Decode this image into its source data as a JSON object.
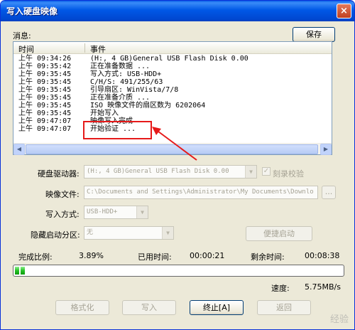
{
  "window": {
    "title": "写入硬盘映像",
    "close_glyph": "×"
  },
  "messages": {
    "label": "消息:",
    "save_button": "保存",
    "columns": {
      "time": "时间",
      "event": "事件"
    },
    "rows": [
      {
        "time": "上午 09:34:26",
        "event": "(H:, 4 GB)General USB Flash Disk  0.00"
      },
      {
        "time": "上午 09:35:42",
        "event": "正在准备数据 ..."
      },
      {
        "time": "上午 09:35:45",
        "event": "写入方式: USB-HDD+"
      },
      {
        "time": "上午 09:35:45",
        "event": "C/H/S: 491/255/63"
      },
      {
        "time": "上午 09:35:45",
        "event": "引导扇区: WinVista/7/8"
      },
      {
        "time": "上午 09:35:45",
        "event": "正在准备介质 ..."
      },
      {
        "time": "上午 09:35:45",
        "event": "ISO 映像文件的扇区数为 6202064"
      },
      {
        "time": "上午 09:35:45",
        "event": "开始写入"
      },
      {
        "time": "上午 09:47:07",
        "event": "映像写入完成"
      },
      {
        "time": "上午 09:47:07",
        "event": "开始验证 ..."
      }
    ],
    "scroll_left": "◀",
    "scroll_right": "▶"
  },
  "form": {
    "drive_label": "硬盘驱动器:",
    "drive_value": "(H:, 4 GB)General USB Flash Disk  0.00",
    "verify_label": "刻录校验",
    "verify_checked": true,
    "image_label": "映像文件:",
    "image_value": "C:\\Documents and Settings\\Administrator\\My Documents\\Downlo",
    "browse_glyph": "...",
    "write_mode_label": "写入方式:",
    "write_mode_value": "USB-HDD+",
    "hidden_partition_label": "隐藏启动分区:",
    "hidden_partition_value": "无",
    "quick_boot_button": "便捷启动",
    "dropdown_glyph": "▼"
  },
  "progress": {
    "percent_label": "完成比例:",
    "percent_value": "3.89%",
    "percent": 3.89,
    "elapsed_label": "已用时间:",
    "elapsed_value": "00:00:21",
    "remaining_label": "剩余时间:",
    "remaining_value": "00:08:38",
    "speed_label": "速度:",
    "speed_value": "5.75MB/s"
  },
  "buttons": {
    "format": "格式化",
    "write": "写入",
    "stop": "终止[A]",
    "back": "返回"
  },
  "watermark": "经验"
}
